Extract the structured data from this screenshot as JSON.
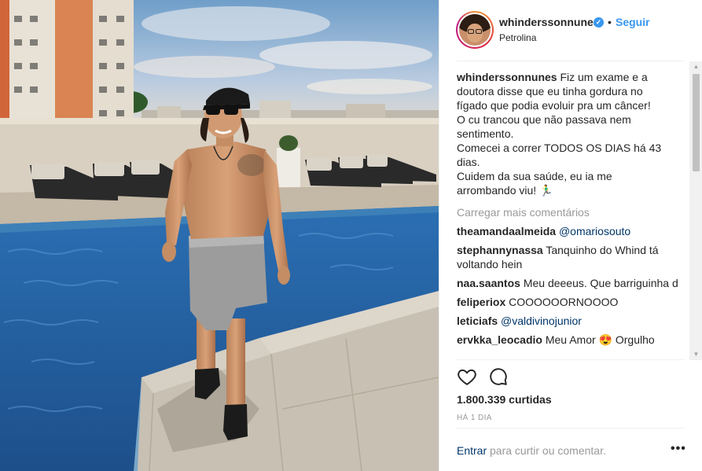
{
  "header": {
    "username": "whinderssonnunes",
    "verified_icon": "verified-badge-icon",
    "separator": "•",
    "follow_label": "Seguir",
    "location": "Petrolina"
  },
  "caption": {
    "username": "whinderssonnunes",
    "lines": [
      "Fiz um exame e a",
      "doutora disse que eu tinha gordura no",
      "fígado que podia evoluir pra um câncer!",
      "O cu trancou que não passava nem",
      "sentimento.",
      "Comecei a correr TODOS OS DIAS há 43",
      "dias.",
      "Cuidem da sua saúde, eu ia me",
      "arrombando viu! 🏃‍♂️"
    ]
  },
  "load_more_label": "Carregar mais comentários",
  "comments": [
    {
      "user": "theamandaalmeida",
      "text": "@omariosouto",
      "mention": true
    },
    {
      "user": "stephannynassa",
      "text": "Tanquinho do Whind tá voltando hein",
      "mention": false
    },
    {
      "user": "naa.saantos",
      "text": "Meu deeeus. Que barriguinha d",
      "mention": false
    },
    {
      "user": "feliperiox",
      "text": "COOOOOORNOOOO",
      "mention": false
    },
    {
      "user": "leticiafs",
      "text": "@valdivinojunior",
      "mention": true
    },
    {
      "user": "ervkka_leocadio",
      "text": "Meu Amor 😍 Orgulho",
      "mention": false
    }
  ],
  "actions": {
    "like_icon": "heart-icon",
    "comment_icon": "comment-icon"
  },
  "likes_text": "1.800.339 curtidas",
  "time_text": "HÁ 1 DIA",
  "footer": {
    "login_label": "Entrar",
    "rest_text": " para curtir ou comentar.",
    "more_label": "•••"
  },
  "colors": {
    "link_blue": "#3897f0",
    "mention_blue": "#003569",
    "muted": "#999999",
    "text": "#262626"
  }
}
